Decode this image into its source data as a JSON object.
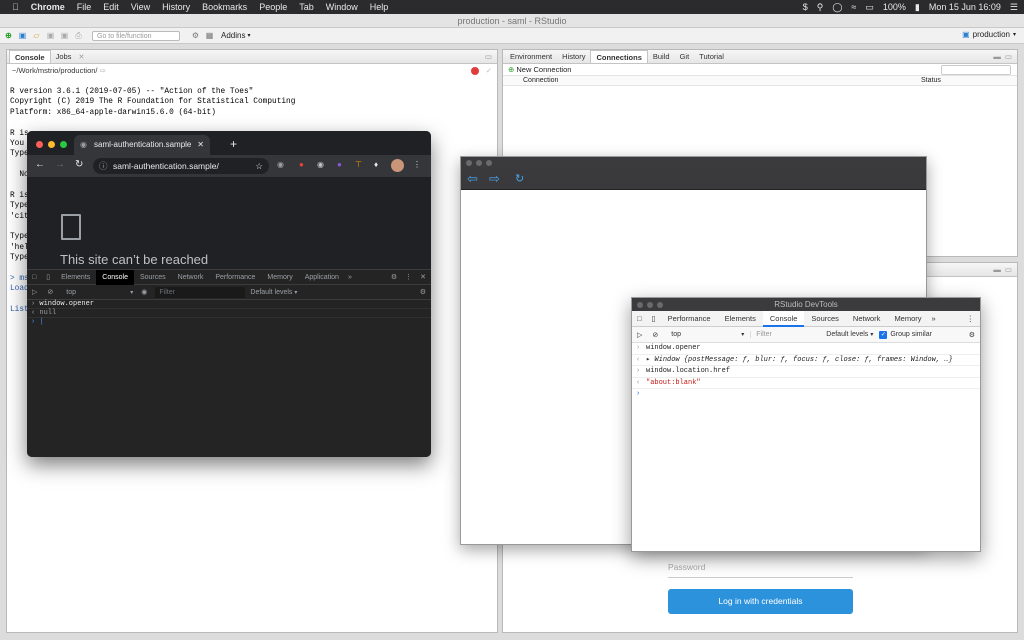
{
  "menubar": {
    "items": [
      "Chrome",
      "File",
      "Edit",
      "View",
      "History",
      "Bookmarks",
      "People",
      "Tab",
      "Window",
      "Help"
    ],
    "battery": "100%",
    "clock": "Mon 15 Jun  16:09"
  },
  "rstudio": {
    "window_title": "production - saml - RStudio",
    "toolbar": {
      "goto_placeholder": "Go to file/function",
      "addins_label": "Addins",
      "project_label": "production"
    },
    "left_pane": {
      "tabs": [
        "Console",
        "Jobs"
      ],
      "path": "~/Work/mstrio/production/",
      "console_lines": [
        "R version 3.6.1 (2019-07-05) -- \"Action of the Toes\"",
        "Copyright (C) 2019 The R Foundation for Statistical Computing",
        "Platform: x86_64-apple-darwin15.6.0 (64-bit)",
        "",
        "R is",
        "You",
        "Type",
        "",
        "  No",
        "",
        "R is",
        "Type",
        "'cit",
        "",
        "Type",
        "'hel",
        "Type",
        "",
        "> ms",
        "Load",
        "",
        "List"
      ]
    },
    "right_top_pane": {
      "tabs": [
        "Environment",
        "History",
        "Connections",
        "Build",
        "Git",
        "Tutorial"
      ],
      "new_connection_label": "New Connection",
      "columns": [
        "Connection",
        "Status"
      ]
    },
    "login": {
      "password_placeholder": "Password",
      "login_button": "Log in with credentials"
    }
  },
  "chrome": {
    "tab_title": "saml-authentication.sample",
    "url": "saml-authentication.sample/",
    "error_title": "This site can’t be reached",
    "devtools": {
      "tabs": [
        "Elements",
        "Console",
        "Sources",
        "Network",
        "Performance",
        "Memory",
        "Application"
      ],
      "context": "top",
      "filter_placeholder": "Filter",
      "levels": "Default levels",
      "lines": [
        "window.opener",
        "null"
      ]
    }
  },
  "rdevtools": {
    "title": "RStudio DevTools",
    "tabs": [
      "Performance",
      "Elements",
      "Console",
      "Sources",
      "Network",
      "Memory"
    ],
    "context": "top",
    "filter_placeholder": "Filter",
    "levels": "Default levels",
    "group_similar": "Group similar",
    "lines": [
      "window.opener",
      "Window {postMessage: ƒ, blur: ƒ, focus: ƒ, close: ƒ, frames: Window, …}",
      "window.location.href",
      "\"about:blank\""
    ]
  },
  "colors": {
    "login_button": "#2d92dc",
    "string_red": "#c41a16"
  }
}
